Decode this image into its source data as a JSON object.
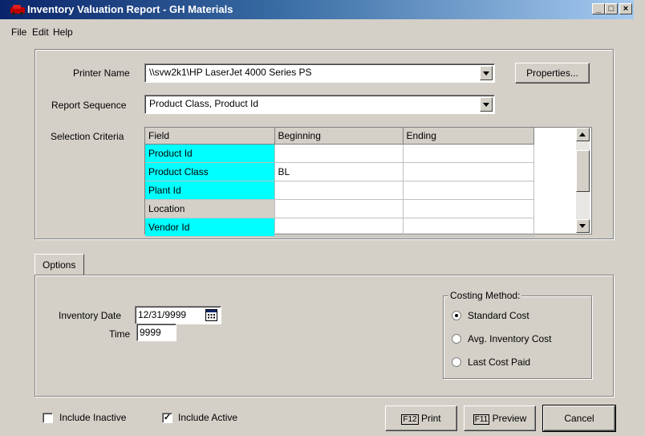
{
  "window": {
    "title": "Inventory Valuation Report - GH Materials",
    "minimize": "_",
    "maximize": "□",
    "close": "×"
  },
  "menu": {
    "file": "File",
    "edit": "Edit",
    "help": "Help"
  },
  "printer": {
    "label": "Printer Name",
    "value": "\\\\svw2k1\\HP LaserJet 4000 Series PS",
    "properties_button": "Properties..."
  },
  "report_sequence": {
    "label": "Report Sequence",
    "value": "Product Class, Product Id"
  },
  "selection_criteria": {
    "label": "Selection Criteria",
    "columns": [
      "Field",
      "Beginning",
      "Ending"
    ],
    "rows": [
      {
        "field": "Product Id",
        "beginning": "",
        "ending": "",
        "required": true
      },
      {
        "field": "Product Class",
        "beginning": "BL",
        "ending": "",
        "required": true
      },
      {
        "field": "Plant Id",
        "beginning": "",
        "ending": "",
        "required": true
      },
      {
        "field": "Location",
        "beginning": "",
        "ending": "",
        "required": false
      },
      {
        "field": "Vendor Id",
        "beginning": "",
        "ending": "",
        "required": true
      }
    ]
  },
  "options_tab": {
    "label": "Options"
  },
  "inventory_date": {
    "label": "Inventory Date",
    "value": "12/31/9999"
  },
  "time": {
    "label": "Time",
    "value": "9999"
  },
  "costing_method": {
    "label": "Costing Method:",
    "options": [
      "Standard Cost",
      "Avg. Inventory Cost",
      "Last Cost Paid"
    ],
    "selected": "Standard Cost"
  },
  "include_inactive": {
    "label": "Include Inactive",
    "checked": false
  },
  "include_active": {
    "label": "Include Active",
    "checked": true
  },
  "buttons": {
    "print_key": "F12",
    "print": "Print",
    "preview_key": "F11",
    "preview": "Preview",
    "cancel": "Cancel"
  }
}
